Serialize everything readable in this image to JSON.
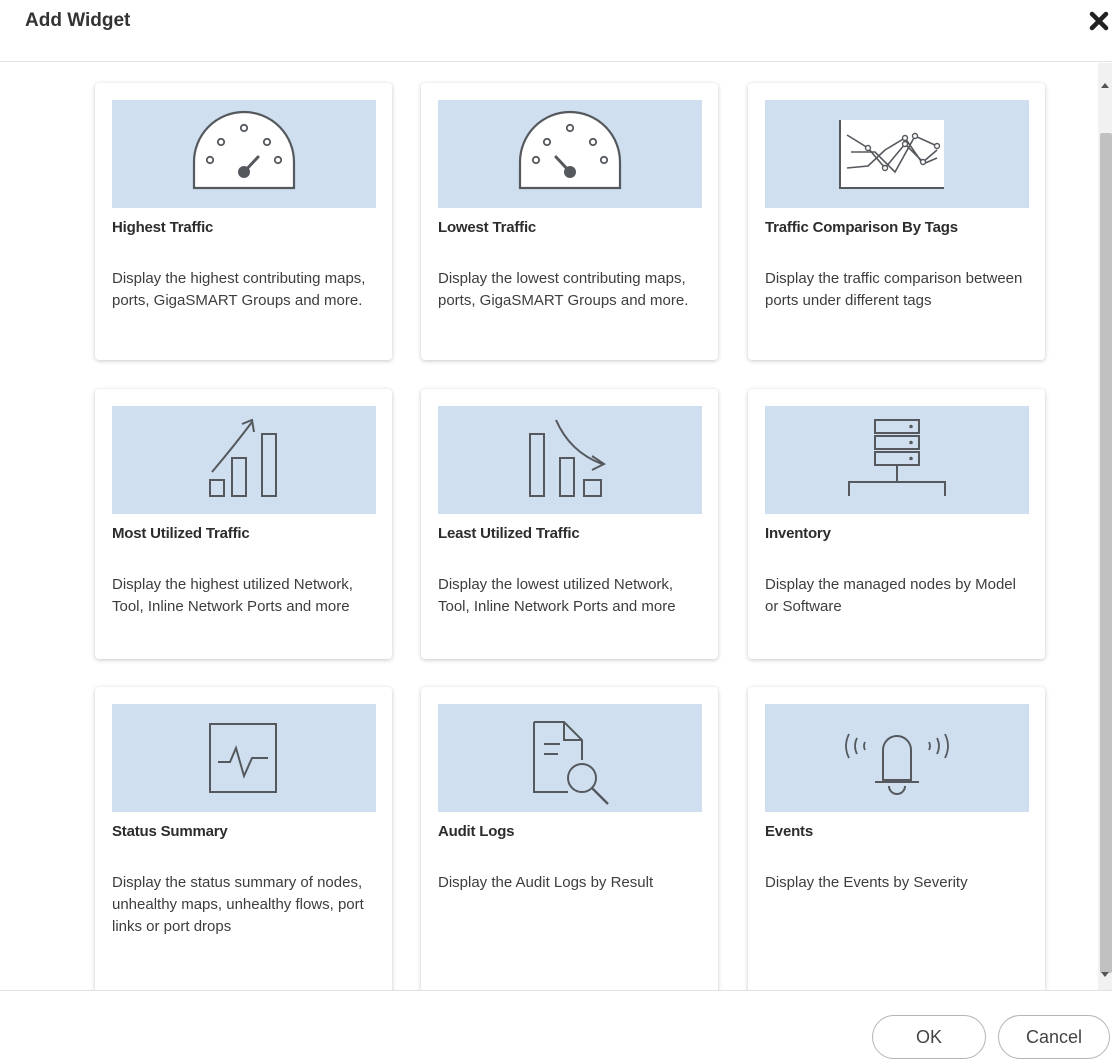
{
  "dialog": {
    "title": "Add Widget",
    "close_icon": "close-x-icon"
  },
  "widgets": [
    {
      "title": "Highest Traffic",
      "description": "Display the highest contributing maps, ports, GigaSMART Groups and more.",
      "icon": "gauge-high-icon"
    },
    {
      "title": "Lowest Traffic",
      "description": "Display the lowest contributing maps, ports, GigaSMART Groups and more.",
      "icon": "gauge-low-icon"
    },
    {
      "title": "Traffic Comparison By Tags",
      "description": "Display the traffic comparison between ports under different tags",
      "icon": "line-comparison-icon"
    },
    {
      "title": "Most Utilized Traffic",
      "description": "Display the highest utilized Network, Tool, Inline Network Ports and more",
      "icon": "bars-rising-icon"
    },
    {
      "title": "Least Utilized Traffic",
      "description": "Display the lowest utilized Network, Tool, Inline Network Ports and more",
      "icon": "bars-falling-icon"
    },
    {
      "title": "Inventory",
      "description": "Display the managed nodes by Model or Software",
      "icon": "server-stack-icon"
    },
    {
      "title": "Status Summary",
      "description": "Display the status summary of nodes, unhealthy maps, unhealthy flows, port links or port drops",
      "icon": "pulse-monitor-icon"
    },
    {
      "title": "Audit Logs",
      "description": "Display the Audit Logs by Result",
      "icon": "document-search-icon"
    },
    {
      "title": "Events",
      "description": "Display the Events by Severity",
      "icon": "ringing-bell-icon"
    }
  ],
  "footer": {
    "ok_label": "OK",
    "cancel_label": "Cancel"
  },
  "colors": {
    "thumb_bg": "#cfdff0",
    "icon_stroke": "#55595e"
  }
}
